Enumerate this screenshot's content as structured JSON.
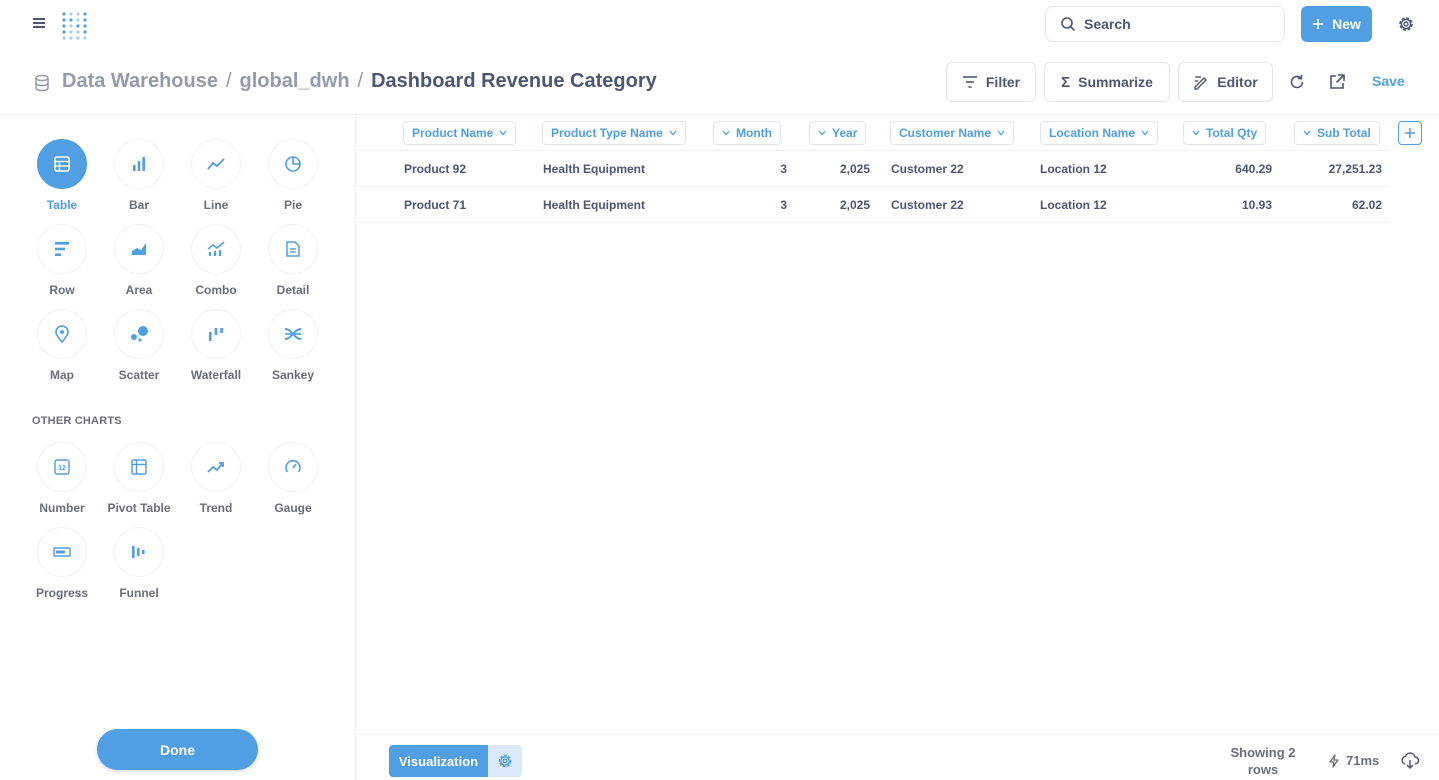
{
  "nav": {
    "search_label": "Search",
    "new_label": "New"
  },
  "header": {
    "breadcrumb": [
      "Data Warehouse",
      "global_dwh"
    ],
    "separator": "/",
    "title": "Dashboard Revenue Category",
    "filter_label": "Filter",
    "summarize_label": "Summarize",
    "editor_label": "Editor",
    "save_label": "Save"
  },
  "sidebar": {
    "charts": [
      {
        "label": "Table",
        "icon": "table-icon",
        "active": true
      },
      {
        "label": "Bar",
        "icon": "bar-icon"
      },
      {
        "label": "Line",
        "icon": "line-icon"
      },
      {
        "label": "Pie",
        "icon": "pie-icon"
      },
      {
        "label": "Row",
        "icon": "row-icon"
      },
      {
        "label": "Area",
        "icon": "area-icon"
      },
      {
        "label": "Combo",
        "icon": "combo-icon"
      },
      {
        "label": "Detail",
        "icon": "detail-icon"
      },
      {
        "label": "Map",
        "icon": "map-icon"
      },
      {
        "label": "Scatter",
        "icon": "scatter-icon"
      },
      {
        "label": "Waterfall",
        "icon": "waterfall-icon"
      },
      {
        "label": "Sankey",
        "icon": "sankey-icon"
      }
    ],
    "other_title": "OTHER CHARTS",
    "other_charts": [
      {
        "label": "Number",
        "icon": "number-icon"
      },
      {
        "label": "Pivot Table",
        "icon": "pivot-table-icon"
      },
      {
        "label": "Trend",
        "icon": "trend-icon"
      },
      {
        "label": "Gauge",
        "icon": "gauge-icon"
      },
      {
        "label": "Progress",
        "icon": "progress-icon"
      },
      {
        "label": "Funnel",
        "icon": "funnel-icon"
      }
    ],
    "done_label": "Done"
  },
  "table": {
    "columns": [
      "Product Name",
      "Product Type Name",
      "Month",
      "Year",
      "Customer Name",
      "Location Name",
      "Total Qty",
      "Sub Total"
    ],
    "rows": [
      [
        "Product 92",
        "Health Equipment",
        "3",
        "2,025",
        "Customer 22",
        "Location 12",
        "640.29",
        "27,251.23"
      ],
      [
        "Product 71",
        "Health Equipment",
        "3",
        "2,025",
        "Customer 22",
        "Location 12",
        "10.93",
        "62.02"
      ]
    ]
  },
  "footer": {
    "visualization_label": "Visualization",
    "showing_line1": "Showing 2",
    "showing_line2": "rows",
    "timing": "71ms"
  },
  "colors": {
    "brand": "#509ee3",
    "text": "#4c5773",
    "muted": "#949aab"
  }
}
